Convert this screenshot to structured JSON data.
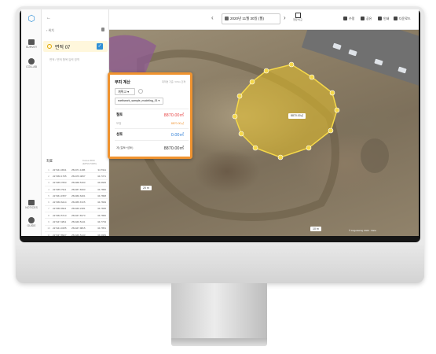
{
  "app": {
    "rail": {
      "files_label": "SURVEY",
      "user_label": "COLLAB",
      "alert_label": "NOTICES",
      "help_label": "GUIDE"
    }
  },
  "sidebar": {
    "back_label": "←",
    "breadcrumb": "‹ 위치",
    "item_name": "면적 07",
    "hint": "면적 / 면적 항목 입력 영역",
    "coords_title": "좌표",
    "coords_meta": "Korea 2000 (EPSG:5186)",
    "coords": [
      [
        "1",
        "227441.3641",
        "252471.1186",
        "34.7911"
      ],
      [
        "2",
        "227450.1795",
        "252476.4837",
        "34.7371"
      ],
      [
        "3",
        "227465.7653",
        "252468.5193",
        "34.6605"
      ],
      [
        "4",
        "227465.7911",
        "252467.8193",
        "34.7860"
      ],
      [
        "5",
        "227461.1557",
        "252460.6401",
        "34.7808"
      ],
      [
        "6",
        "227456.6214",
        "252455.6725",
        "34.7829"
      ],
      [
        "7",
        "227456.9911",
        "252449.2181",
        "34.7835"
      ],
      [
        "8",
        "227452.5713",
        "252447.8173",
        "34.7860"
      ],
      [
        "9",
        "227447.4811",
        "252446.5141",
        "34.7733"
      ],
      [
        "10",
        "227441.0155",
        "252447.9815",
        "34.7851"
      ],
      [
        "11",
        "227437.8937",
        "252449.5143",
        "34.6983"
      ]
    ]
  },
  "topbar": {
    "date": "2020년 11월 30일 (월)",
    "compare_label": "현장 비교",
    "tools": [
      {
        "icon": "pencil-icon",
        "label": "수정"
      },
      {
        "icon": "share-icon",
        "label": "공유"
      },
      {
        "icon": "print-icon",
        "label": "인쇄"
      },
      {
        "icon": "download-icon",
        "label": "다운로드"
      }
    ]
  },
  "calc": {
    "title": "부피 계산",
    "subtitle": "최저면 기준 / 0.5m 간격",
    "method": "계획고 ▾",
    "file": "earthwork_sample_modeling_01 ▾",
    "rows": [
      {
        "label": "절토",
        "value": "8870.00㎥",
        "color": "#e84545"
      },
      {
        "label": "보정",
        "value": "8870.00㎥",
        "color": "#f0932f",
        "small": true
      },
      {
        "label": "성토",
        "value": "0.00㎥",
        "color": "#2f7fd6"
      },
      {
        "label": "계 (절토+성토)",
        "value": "8870.00㎥",
        "color": "#333333",
        "total": true
      }
    ]
  },
  "map": {
    "pile_label": "8870.00㎥",
    "scale_label": "10 m",
    "side_label": "20 m",
    "attribution": "© Angelswing 2020 · Data"
  },
  "colors": {
    "accent": "#2f8fd6",
    "highlight_border": "#f0932f",
    "polygon_fill": "#e8c12a",
    "polygon_vertex": "#f5d84a"
  }
}
